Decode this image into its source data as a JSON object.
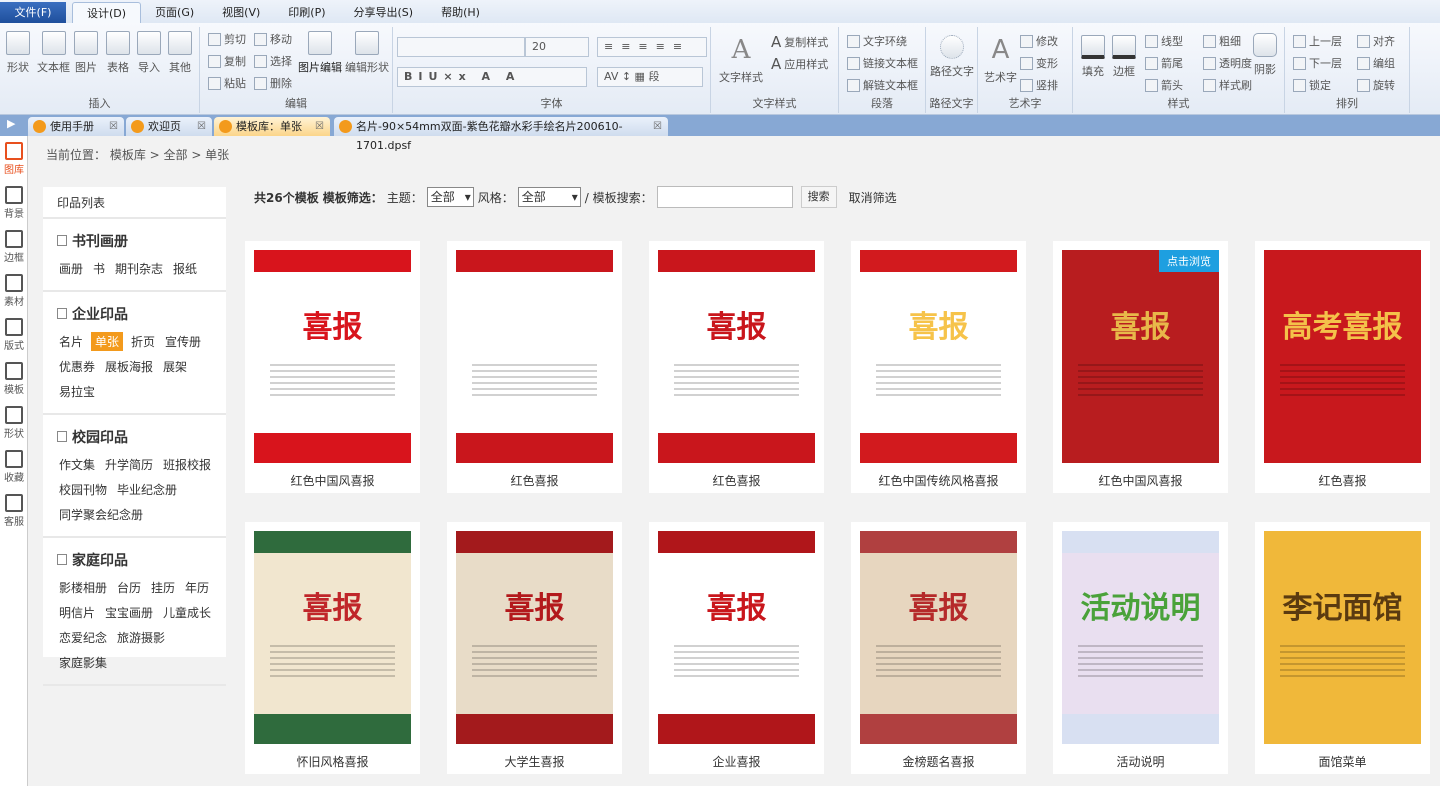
{
  "menu": [
    "文件(F)",
    "设计(D)",
    "页面(G)",
    "视图(V)",
    "印刷(P)",
    "分享导出(S)",
    "帮助(H)"
  ],
  "ribbon": {
    "insert": {
      "label": "插入",
      "items": [
        "形状",
        "文本框",
        "图片",
        "表格",
        "导入",
        "其他"
      ]
    },
    "edit": {
      "label": "编辑",
      "cut": "剪切",
      "move": "移动",
      "copy": "复制",
      "select": "选择",
      "paste": "粘贴",
      "delete": "删除",
      "image_edit": "图片编辑",
      "shape_edit": "编辑形状"
    },
    "font": {
      "label": "字体",
      "font_name": "",
      "font_size": "20"
    },
    "textstyle": {
      "label": "文字样式",
      "main": "文字样式",
      "copy": "复制样式",
      "apply": "应用样式"
    },
    "para": {
      "label": "段落",
      "wrap": "文字环绕",
      "link": "链接文本框",
      "unlink": "解链文本框"
    },
    "path": {
      "label": "路径文字",
      "main": "路径文字"
    },
    "art": {
      "label": "艺术字",
      "main": "艺术字",
      "modify": "修改",
      "transform": "变形",
      "vertical": "竖排"
    },
    "style": {
      "label": "样式",
      "fill": "填充",
      "border": "边框",
      "linetype": "线型",
      "thickness": "粗细",
      "arrowtail": "箭尾",
      "transparency": "透明度",
      "arrowhead": "箭头",
      "brush": "样式刷",
      "shadow": "阴影"
    },
    "arrange": {
      "label": "排列",
      "up": "上一层",
      "align": "对齐",
      "down": "下一层",
      "group": "编组",
      "lock": "锁定",
      "rotate": "旋转"
    }
  },
  "tabs": [
    "使用手册",
    "欢迎页",
    "模板库：单张",
    "名片-90×54mm双面-紫色花瓣水彩手绘名片200610-1701.dpsf"
  ],
  "leftbar": [
    "图库",
    "背景",
    "边框",
    "素材",
    "版式",
    "模板",
    "形状",
    "收藏",
    "客服"
  ],
  "breadcrumb": "当前位置： 模板库 > 全部 > 单张",
  "sidebar": {
    "title": "印品列表",
    "categories": [
      {
        "name": "书刊画册",
        "items": [
          "画册",
          "书",
          "期刊杂志",
          "报纸"
        ]
      },
      {
        "name": "企业印品",
        "items": [
          "名片",
          "单张",
          "折页",
          "宣传册",
          "优惠券",
          "展板海报",
          "展架",
          "易拉宝"
        ]
      },
      {
        "name": "校园印品",
        "items": [
          "作文集",
          "升学简历",
          "班报校报",
          "校园刊物",
          "毕业纪念册",
          "同学聚会纪念册"
        ]
      },
      {
        "name": "家庭印品",
        "items": [
          "影楼相册",
          "台历",
          "挂历",
          "年历",
          "明信片",
          "宝宝画册",
          "儿童成长",
          "恋爱纪念",
          "旅游摄影",
          "家庭影集"
        ]
      }
    ],
    "selected": "单张"
  },
  "filter": {
    "count": "共26个模板",
    "label": "模板筛选：",
    "theme_label": "主题：",
    "theme": "全部",
    "style_label": "风格：",
    "style": "全部",
    "search_label": "/ 模板搜索：",
    "search_value": "",
    "search_btn": "搜索",
    "cancel": "取消筛选"
  },
  "preview_badge": "点击浏览",
  "templates": [
    {
      "name": "红色中国风喜报",
      "title": "喜报",
      "bg": "#d8141c",
      "fg": "#d8141c",
      "paper": "#fff"
    },
    {
      "name": "红色喜报",
      "title": "喜报",
      "bg": "#c9161c",
      "fg": "#fff",
      "paper": "#fff"
    },
    {
      "name": "红色喜报",
      "title": "喜报",
      "bg": "#c9161c",
      "fg": "#c9161c",
      "paper": "#fff"
    },
    {
      "name": "红色中国传统风格喜报",
      "title": "喜报",
      "bg": "#d21a1e",
      "fg": "#f6c34a",
      "paper": "#fff"
    },
    {
      "name": "红色中国风喜报",
      "title": "喜报",
      "bg": "#b81d1f",
      "fg": "#e8b84a",
      "paper": "#b81d1f"
    },
    {
      "name": "红色喜报",
      "title": "高考喜报",
      "bg": "#c8181d",
      "fg": "#f4c24a",
      "paper": "#c8181d"
    },
    {
      "name": "怀旧风格喜报",
      "title": "喜报",
      "bg": "#2f6b3d",
      "fg": "#c0262a",
      "paper": "#f1e6cf"
    },
    {
      "name": "大学生喜报",
      "title": "喜报",
      "bg": "#a31a1c",
      "fg": "#b3191c",
      "paper": "#e8dcc8"
    },
    {
      "name": "企业喜报",
      "title": "喜报",
      "bg": "#b0161a",
      "fg": "#c9161c",
      "paper": "#fff"
    },
    {
      "name": "金榜题名喜报",
      "title": "喜报",
      "bg": "#b04040",
      "fg": "#b52a2a",
      "paper": "#e7d6bf"
    },
    {
      "name": "活动说明",
      "title": "活动说明",
      "bg": "#d8e0f2",
      "fg": "#4aa23a",
      "paper": "#e9dff0"
    },
    {
      "name": "面馆菜单",
      "title": "李记面馆",
      "bg": "#f0b83a",
      "fg": "#5a3a10",
      "paper": "#f0b83a"
    }
  ]
}
